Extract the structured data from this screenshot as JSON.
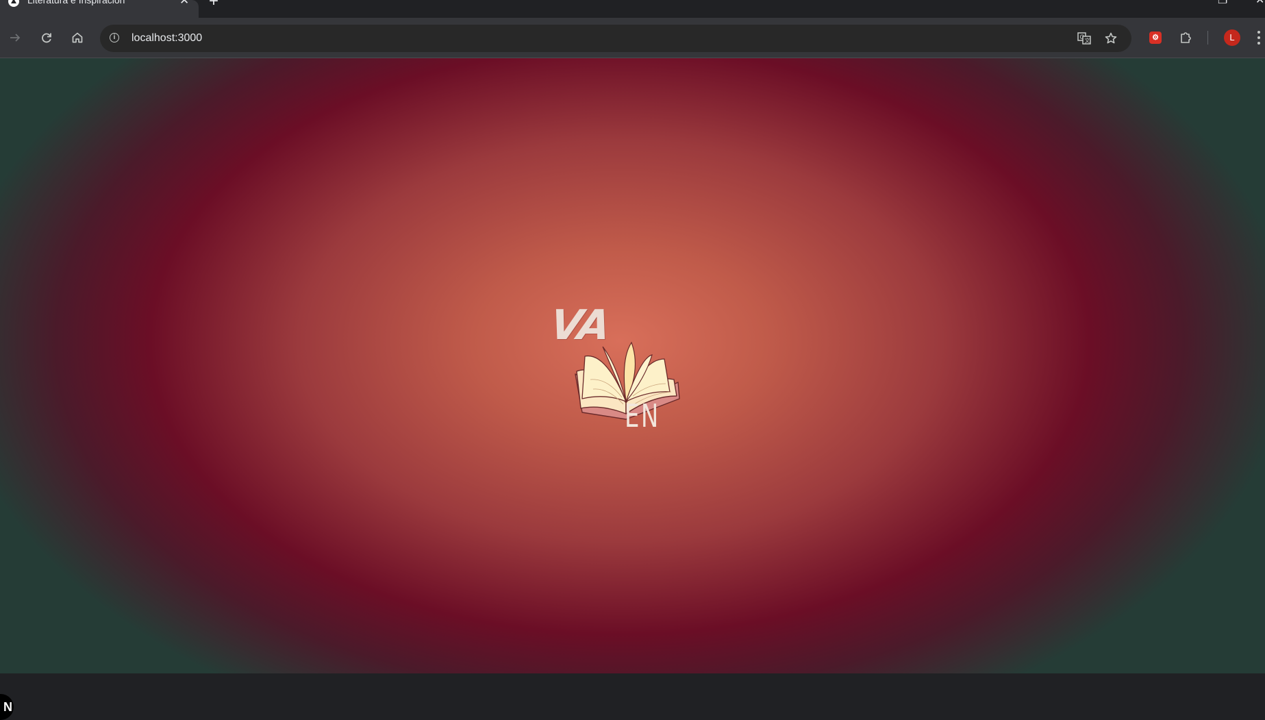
{
  "browser": {
    "tab": {
      "title": "Literatura e Inspiración",
      "favicon": "vercel-triangle-icon",
      "close_glyph": "✕"
    },
    "new_tab_glyph": "+",
    "toolbar": {
      "back_icon": "arrow-forward-icon",
      "reload_icon": "reload-icon",
      "home_icon": "home-icon",
      "url": "localhost:3000",
      "site_info_glyph": "i",
      "translate_icon": "translate-icon",
      "bookmark_icon": "star-icon",
      "extensions": [
        "puzzle-extension-icon",
        "extensions-icon"
      ],
      "profile_initial": "L",
      "profile_color": "#c5281c"
    }
  },
  "page": {
    "logo": {
      "top_text": "VA",
      "bottom_text": "EN",
      "image": "open-book-icon"
    },
    "colors": {
      "center": "#d86f5a",
      "mid": "#6b0e26",
      "edge": "#253c36"
    },
    "dev_badge": "N"
  }
}
